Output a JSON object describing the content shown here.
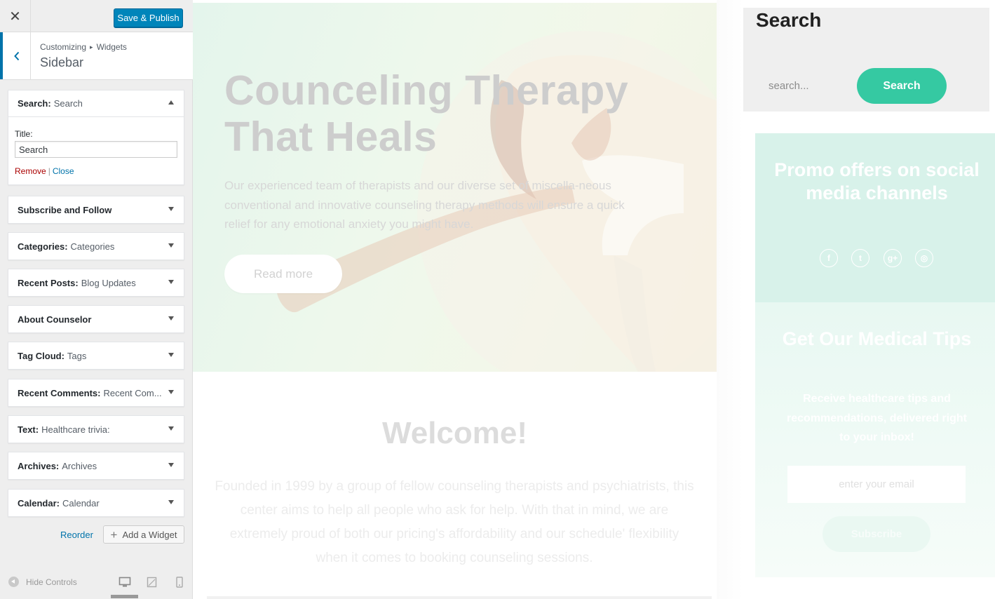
{
  "customizer": {
    "close_glyph": "✕",
    "publish_label": "Save & Publish",
    "breadcrumb": {
      "root": "Customizing",
      "sep": "▸",
      "current": "Widgets"
    },
    "section_title": "Sidebar",
    "open_widget": {
      "name": "Search:",
      "title": "Search",
      "field_label": "Title:",
      "field_value": "Search",
      "remove": "Remove",
      "pipe": "|",
      "close": "Close"
    },
    "widgets": [
      {
        "name": "Subscribe and Follow",
        "title": ""
      },
      {
        "name": "Categories:",
        "title": "Categories"
      },
      {
        "name": "Recent Posts:",
        "title": "Blog Updates"
      },
      {
        "name": "About Counselor",
        "title": ""
      },
      {
        "name": "Tag Cloud:",
        "title": "Tags"
      },
      {
        "name": "Recent Comments:",
        "title": "Recent Com..."
      },
      {
        "name": "Text:",
        "title": "Healthcare trivia:"
      },
      {
        "name": "Archives:",
        "title": "Archives"
      },
      {
        "name": "Calendar:",
        "title": "Calendar"
      }
    ],
    "reorder": "Reorder",
    "add_widget": "Add a Widget",
    "add_plus": "+",
    "hide_controls": "Hide Controls",
    "accent_color": "#0085ba"
  },
  "preview": {
    "hero": {
      "title": "Counceling Therapy That Heals",
      "text": "Our experienced team of therapists and our diverse set of miscella-neous conventional and innovative counseling therapy methods will ensure a quick relief for any emotional anxiety you might have.",
      "button": "Read more"
    },
    "welcome": {
      "title": "Welcome!",
      "text": "Founded in 1999 by a group of fellow counseling therapists and psychiatrists, this center aims to help all people who ask for help. With that in mind, we are extremely proud of both our pricing's affordability and our schedule' flexibility when it comes to booking counseling sessions."
    },
    "search": {
      "title": "Search",
      "placeholder": "search...",
      "button": "Search",
      "button_color": "#35c9a2"
    },
    "promo": {
      "title": "Promo offers on social media channels",
      "social": [
        {
          "icon": "facebook-icon",
          "glyph": "f"
        },
        {
          "icon": "twitter-icon",
          "glyph": "t"
        },
        {
          "icon": "google-plus-icon",
          "glyph": "g+"
        },
        {
          "icon": "instagram-icon",
          "glyph": "◎"
        }
      ]
    },
    "tips": {
      "title": "Get Our Medical Tips",
      "text": "Receive healthcare tips and recommendations, delivered right to your inbox!",
      "placeholder": "enter your email",
      "button": "Subscribe"
    }
  }
}
